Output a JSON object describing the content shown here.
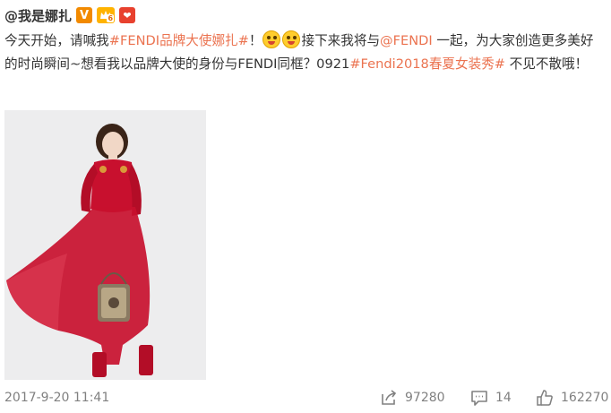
{
  "header": {
    "username": "@我是娜扎",
    "verified_badge": "V",
    "member_level": "6",
    "red_badge": "❤"
  },
  "content": {
    "line1_a": "今天开始，请喊我",
    "hashtag1": "#FENDI品牌大使娜扎#",
    "line1_b": "！",
    "line1_c": "接下来我将与",
    "mention": "@FENDI",
    "line1_d": " 一起，为大家创造更多美好的时尚瞬间~想看我以品牌大使的身份与FENDI同框？0921",
    "hashtag2": "#Fendi2018春夏女装秀#",
    "line1_e": " 不见不散哦！"
  },
  "image": {
    "alt": ""
  },
  "footer": {
    "timestamp": "2017-9-20 11:41",
    "reposts": "97280",
    "comments": "14",
    "likes": "162270"
  },
  "colors": {
    "accent": "#eb7350",
    "text": "#333333",
    "muted": "#808080",
    "verified": "#f28a00",
    "dress": "#c8102e"
  },
  "icons": {
    "repost": "share-arrow-icon",
    "comment": "comment-bubble-icon",
    "like": "thumbs-up-icon",
    "emoji": "grinning-face-icon"
  }
}
